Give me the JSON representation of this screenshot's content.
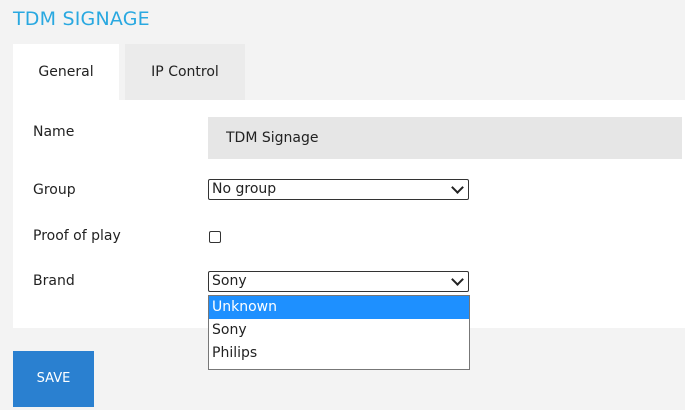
{
  "title": "TDM SIGNAGE",
  "tabs": [
    {
      "label": "General",
      "active": true
    },
    {
      "label": "IP Control",
      "active": false
    }
  ],
  "form": {
    "name_label": "Name",
    "name_value": "TDM Signage",
    "group_label": "Group",
    "group_value": "No group",
    "proof_label": "Proof of play",
    "proof_checked": false,
    "brand_label": "Brand",
    "brand_value": "Sony",
    "brand_options": [
      "Unknown",
      "Sony",
      "Philips"
    ],
    "brand_highlighted": "Unknown"
  },
  "save_label": "SAVE",
  "colors": {
    "accent": "#29a8e0",
    "button": "#2a80d0",
    "highlight": "#1e90ff"
  }
}
